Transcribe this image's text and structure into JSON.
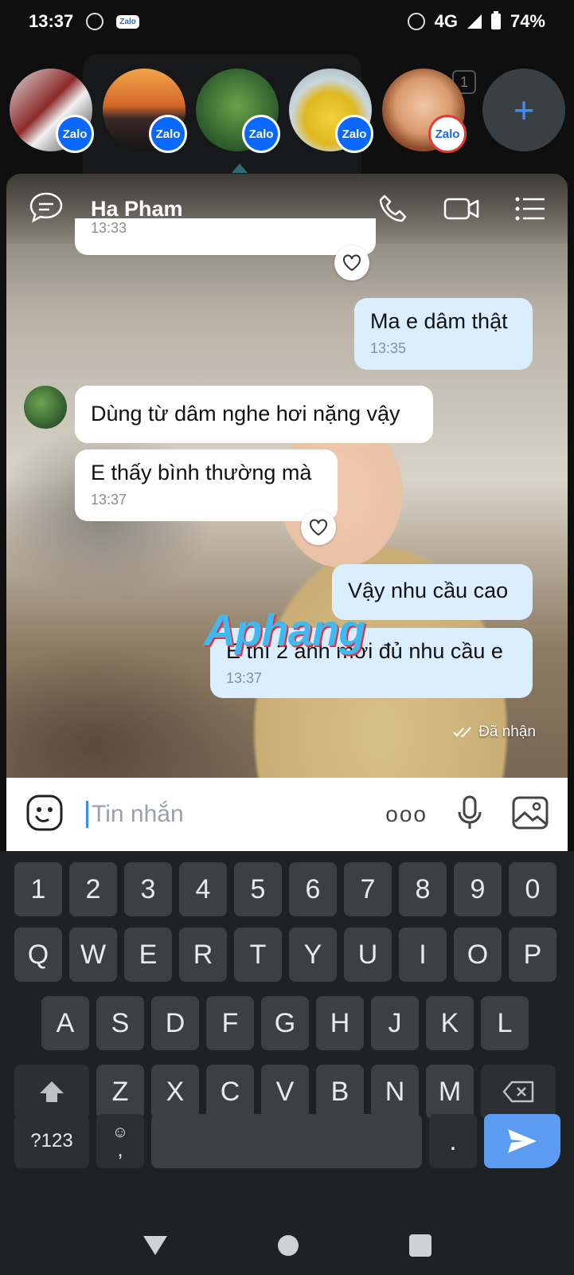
{
  "status_bar": {
    "time": "13:37",
    "network": "4G",
    "battery": "74%"
  },
  "bubble_heads": {
    "badge_label": "Zalo",
    "count": "1",
    "plus": "+"
  },
  "chat": {
    "contact_name": "Ha Pham",
    "partial_time": "13:33",
    "messages": [
      {
        "text": "Ma e dâm thật",
        "time": "13:35",
        "from": "me"
      },
      {
        "text": "Dùng từ dâm nghe hơi nặng vậy",
        "time": "",
        "from": "them"
      },
      {
        "text": "E thấy bình thường mà",
        "time": "13:37",
        "from": "them"
      },
      {
        "text": "Vậy nhu cầu cao",
        "time": "",
        "from": "me"
      },
      {
        "text": "E thì 2 anh mới đủ nhu cầu e",
        "time": "13:37",
        "from": "me"
      }
    ],
    "delivered": "Đã nhận",
    "watermark": "Aphang"
  },
  "composer": {
    "placeholder": "Tin nhắn",
    "more": "ooo"
  },
  "keyboard": {
    "row_numbers": [
      "1",
      "2",
      "3",
      "4",
      "5",
      "6",
      "7",
      "8",
      "9",
      "0"
    ],
    "row1": [
      "Q",
      "W",
      "E",
      "R",
      "T",
      "Y",
      "U",
      "I",
      "O",
      "P"
    ],
    "row2": [
      "A",
      "S",
      "D",
      "F",
      "G",
      "H",
      "J",
      "K",
      "L"
    ],
    "row3": [
      "Z",
      "X",
      "C",
      "V",
      "B",
      "N",
      "M"
    ],
    "symbols": "?123",
    "comma": ",",
    "period": "."
  },
  "colors": {
    "accent": "#3d8ef7",
    "bubble_me": "#dbeeff",
    "keyboard_bg": "#202124",
    "key": "#3c4043",
    "send": "#5b9bf2"
  }
}
